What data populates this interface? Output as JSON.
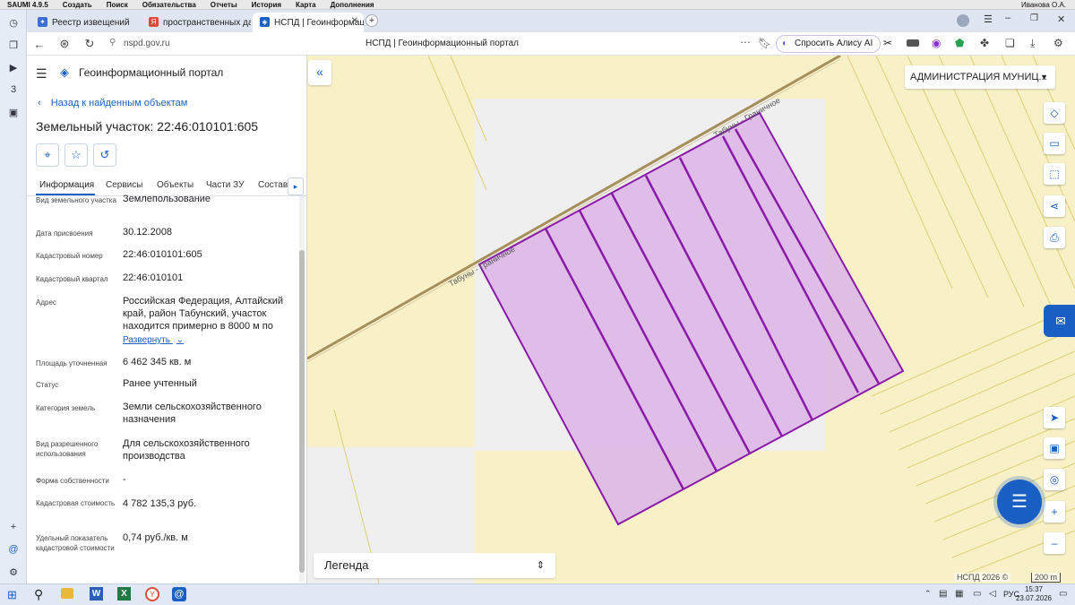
{
  "menubar": {
    "app_name": "SAUMI 4.9.5",
    "items": [
      "Создать",
      "Поиск",
      "Обязательства",
      "Отчеты",
      "История",
      "Карта",
      "Дополнения"
    ],
    "user": "Иванова О.А."
  },
  "browser": {
    "tabs": [
      {
        "label": "Реестр извещений",
        "active": false
      },
      {
        "label": "пространственных данн",
        "active": false
      },
      {
        "label": "НСПД | Геоинформацио",
        "active": true
      }
    ],
    "url": "nspd.gov.ru",
    "page_title": "НСПД | Геоинформационный портал",
    "alice_button": "Спросить Алису AI"
  },
  "portal": {
    "title": "Геоинформационный портал",
    "back_link": "Назад к найденным объектам",
    "object_title": "Земельный участок: 22:46:010101:605",
    "tabs": [
      "Информация",
      "Сервисы",
      "Объекты",
      "Части ЗУ",
      "Состав"
    ],
    "fields": [
      {
        "label": "Вид земельного участка",
        "value": "Землепользование"
      },
      {
        "label": "Дата присвоения",
        "value": "30.12.2008"
      },
      {
        "label": "Кадастровый номер",
        "value": "22:46:010101:605"
      },
      {
        "label": "Кадастровый квартал",
        "value": "22:46:010101"
      },
      {
        "label": "Адрес",
        "value": "Российская Федерация, Алтайский край, район Табунский, участок находится примерно в 8000 м по"
      },
      {
        "label": "Площадь уточненная",
        "value": "6 462 345 кв. м"
      },
      {
        "label": "Статус",
        "value": "Ранее учтенный"
      },
      {
        "label": "Категория земель",
        "value": "Земли сельскохозяйственного назначения"
      },
      {
        "label": "Вид разрешенного использования",
        "value": "Для сельскохозяйственного производства"
      },
      {
        "label": "Форма собственности",
        "value": "-"
      },
      {
        "label": "Кадастровая стоимость",
        "value": "4 782 135,3 руб."
      },
      {
        "label": "Удельный показатель кадастровой стоимости",
        "value": "0,74 руб./кв. м"
      }
    ],
    "expand_link": "Развернуть"
  },
  "map": {
    "admin_dropdown": "АДМИНИСТРАЦИЯ МУНИЦ...",
    "legend": "Легенда",
    "road_labels": [
      "Табуны - Граничное",
      "Табуны - Граничное"
    ],
    "copyright": "НСПД 2026 ©",
    "scale": "200 m"
  },
  "taskbar": {
    "lang": "РУС",
    "time": "15:37",
    "date": "23.07.2026"
  },
  "colors": {
    "accent": "#1a5fc4",
    "parcel_fill": "#dcb4e6",
    "parcel_stroke": "#8a1aa8",
    "map_bg": "#f8f1c8"
  }
}
